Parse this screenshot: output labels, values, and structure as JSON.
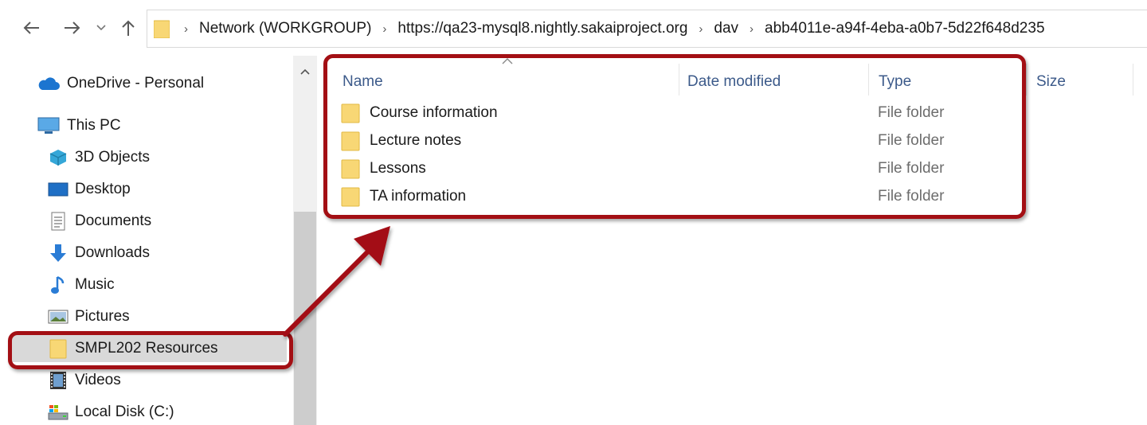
{
  "navigation": {
    "back_icon": "back-arrow-icon",
    "forward_icon": "forward-arrow-icon",
    "recent_icon": "chevron-down-icon",
    "up_icon": "up-arrow-icon"
  },
  "address_bar": {
    "crumbs": [
      "Network (WORKGROUP)",
      "https://qa23-mysql8.nightly.sakaiproject.org",
      "dav",
      "abb4011e-a94f-4eba-a0b7-5d22f648d235"
    ]
  },
  "sidebar": {
    "onedrive": "OneDrive - Personal",
    "this_pc": "This PC",
    "items": [
      {
        "label": "3D Objects",
        "icon": "3d-objects-icon"
      },
      {
        "label": "Desktop",
        "icon": "desktop-icon"
      },
      {
        "label": "Documents",
        "icon": "documents-icon"
      },
      {
        "label": "Downloads",
        "icon": "downloads-icon"
      },
      {
        "label": "Music",
        "icon": "music-icon"
      },
      {
        "label": "Pictures",
        "icon": "pictures-icon"
      },
      {
        "label": "SMPL202 Resources",
        "icon": "folder-icon"
      },
      {
        "label": "Videos",
        "icon": "videos-icon"
      },
      {
        "label": "Local Disk (C:)",
        "icon": "local-disk-icon"
      }
    ]
  },
  "file_list": {
    "columns": [
      "Name",
      "Date modified",
      "Type",
      "Size"
    ],
    "rows": [
      {
        "name": "Course information",
        "type": "File folder"
      },
      {
        "name": "Lecture notes",
        "type": "File folder"
      },
      {
        "name": "Lessons",
        "type": "File folder"
      },
      {
        "name": "TA information",
        "type": "File folder"
      }
    ]
  },
  "colors": {
    "highlight": "#a30f14",
    "folder": "#f8d775",
    "header_text": "#3c5a8a"
  }
}
